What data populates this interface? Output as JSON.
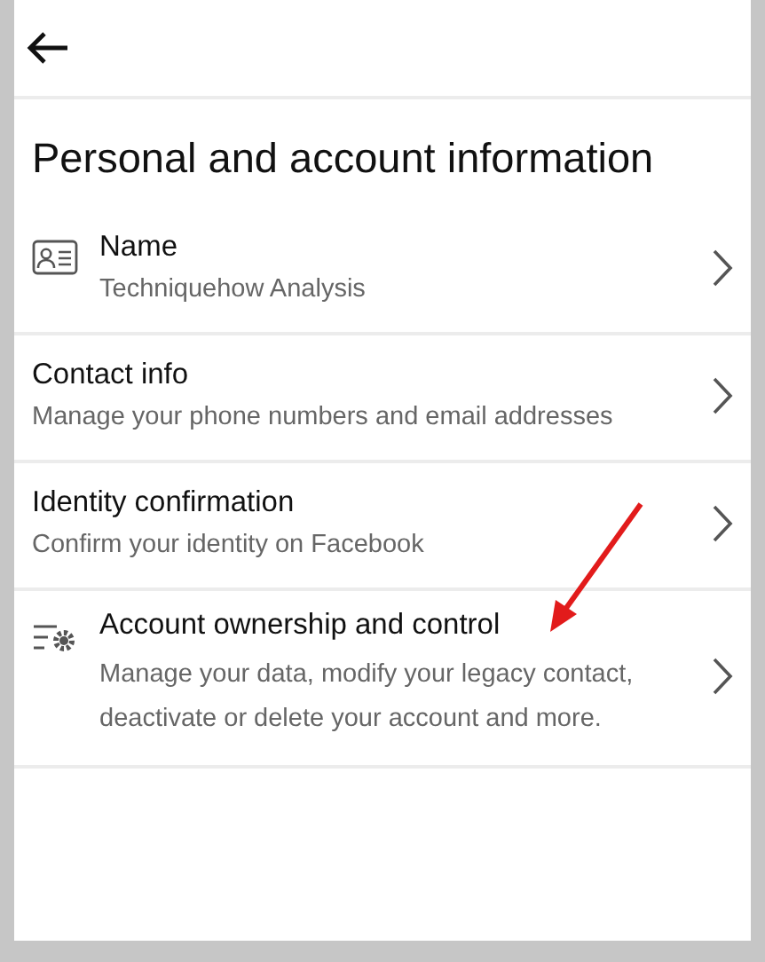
{
  "title": "Personal and account information",
  "items": [
    {
      "kind": "card",
      "label": "Name",
      "detail": "Techniquehow Analysis"
    },
    {
      "kind": "plain",
      "label": "Contact info",
      "detail": "Manage your phone numbers and email addresses"
    },
    {
      "kind": "plain",
      "label": "Identity confirmation",
      "detail": "Confirm your identity on Facebook"
    },
    {
      "kind": "settings",
      "label": "Account ownership and control",
      "detail": "Manage your data, modify your legacy contact, deactivate or delete your account and more."
    }
  ]
}
